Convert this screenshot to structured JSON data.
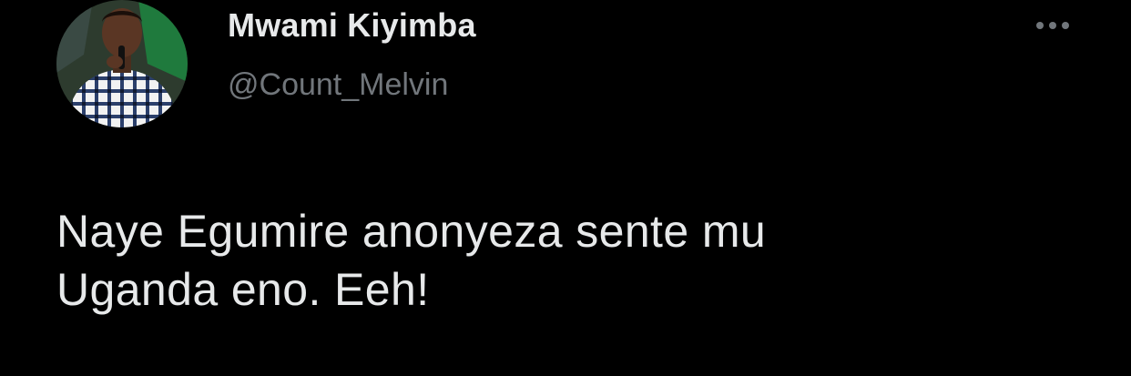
{
  "tweet": {
    "author": {
      "display_name": "Mwami Kiyimba",
      "handle": "@Count_Melvin",
      "avatar_icon": "user-avatar-photo"
    },
    "menu_icon": "more-horizontal-icon",
    "text": "Naye Egumire anonyeza sente mu\nUganda eno. Eeh!"
  },
  "colors": {
    "background": "#000000",
    "primary_text": "#e7e9ea",
    "secondary_text": "#71767b"
  }
}
